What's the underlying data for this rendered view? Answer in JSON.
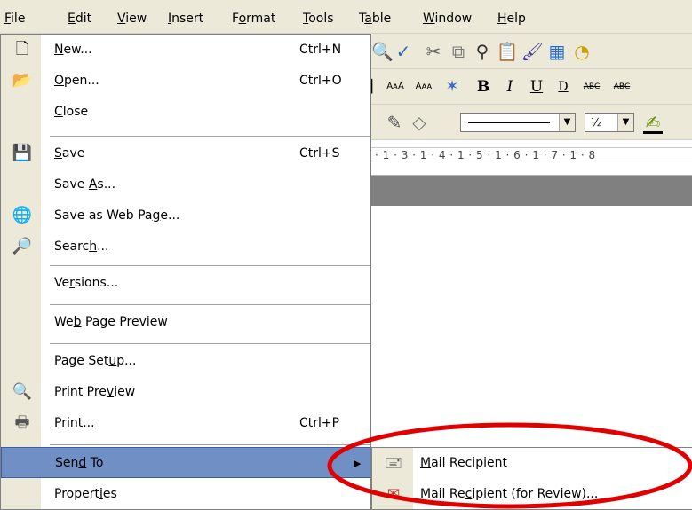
{
  "menubar": {
    "items": [
      {
        "text": "File",
        "u": "F",
        "rest": "ile"
      },
      {
        "text": "Edit",
        "u": "E",
        "rest": "dit"
      },
      {
        "text": "View",
        "u": "V",
        "rest": "iew"
      },
      {
        "text": "Insert",
        "u": "I",
        "rest": "nsert"
      },
      {
        "text": "Format",
        "pre": "F",
        "u": "o",
        "rest": "rmat"
      },
      {
        "text": "Tools",
        "u": "T",
        "rest": "ools"
      },
      {
        "text": "Table",
        "pre": "T",
        "u": "a",
        "rest": "ble"
      },
      {
        "text": "Window",
        "u": "W",
        "rest": "indow"
      },
      {
        "text": "Help",
        "u": "H",
        "rest": "elp"
      }
    ]
  },
  "toolbar": {
    "format_b": "B",
    "format_i": "I",
    "format_u": "U",
    "format_d": "D",
    "format_abc1": "ABC",
    "format_abc2": "ABC",
    "aa1": "AᴀA",
    "aa2": "Aᴀᴀ",
    "fraction": "½"
  },
  "ruler": {
    "text": "· 1 · 3 · 1 · 4 · 1 · 5 · 1 · 6 · 1 · 7 · 1 · 8"
  },
  "file_menu": {
    "items": [
      {
        "label_pre": "",
        "u": "N",
        "label_post": "ew...",
        "shortcut": "Ctrl+N",
        "icon": "new-document-icon"
      },
      {
        "label_pre": "",
        "u": "O",
        "label_post": "pen...",
        "shortcut": "Ctrl+O",
        "icon": "open-folder-icon"
      },
      {
        "label_pre": "",
        "u": "C",
        "label_post": "lose",
        "shortcut": "",
        "icon": ""
      },
      {
        "label_pre": "",
        "u": "S",
        "label_post": "ave",
        "shortcut": "Ctrl+S",
        "icon": "save-disk-icon"
      },
      {
        "label_pre": "Save ",
        "u": "A",
        "label_post": "s...",
        "shortcut": "",
        "icon": ""
      },
      {
        "label_pre": "Save as Web Pa",
        "u": "g",
        "label_post": "e...",
        "shortcut": "",
        "icon": "web-page-icon"
      },
      {
        "label_pre": "Searc",
        "u": "h",
        "label_post": "...",
        "shortcut": "",
        "icon": "search-icon"
      },
      {
        "label_pre": "Ve",
        "u": "r",
        "label_post": "sions...",
        "shortcut": "",
        "icon": ""
      },
      {
        "label_pre": "We",
        "u": "b",
        "label_post": " Page Preview",
        "shortcut": "",
        "icon": ""
      },
      {
        "label_pre": "Page Set",
        "u": "u",
        "label_post": "p...",
        "shortcut": "",
        "icon": ""
      },
      {
        "label_pre": "Print Pre",
        "u": "v",
        "label_post": "iew",
        "shortcut": "",
        "icon": "print-preview-icon"
      },
      {
        "label_pre": "",
        "u": "P",
        "label_post": "rint...",
        "shortcut": "Ctrl+P",
        "icon": "printer-icon"
      },
      {
        "label_pre": "Sen",
        "u": "d",
        "label_post": " To",
        "shortcut": "",
        "icon": ""
      },
      {
        "label_pre": "Propert",
        "u": "i",
        "label_post": "es",
        "shortcut": "",
        "icon": ""
      }
    ]
  },
  "send_to_menu": {
    "items": [
      {
        "label_pre": "",
        "u": "M",
        "label_post": "ail Recipient",
        "icon": "mail-recipient-icon"
      },
      {
        "label_pre": "Mail Re",
        "u": "c",
        "label_post": "ipient (for Review)...",
        "icon": "mail-review-icon"
      }
    ]
  },
  "colors": {
    "menu_gutter": "#ece9d8",
    "selection": "#6f8fc5",
    "highlight_ellipse": "#e00000"
  }
}
